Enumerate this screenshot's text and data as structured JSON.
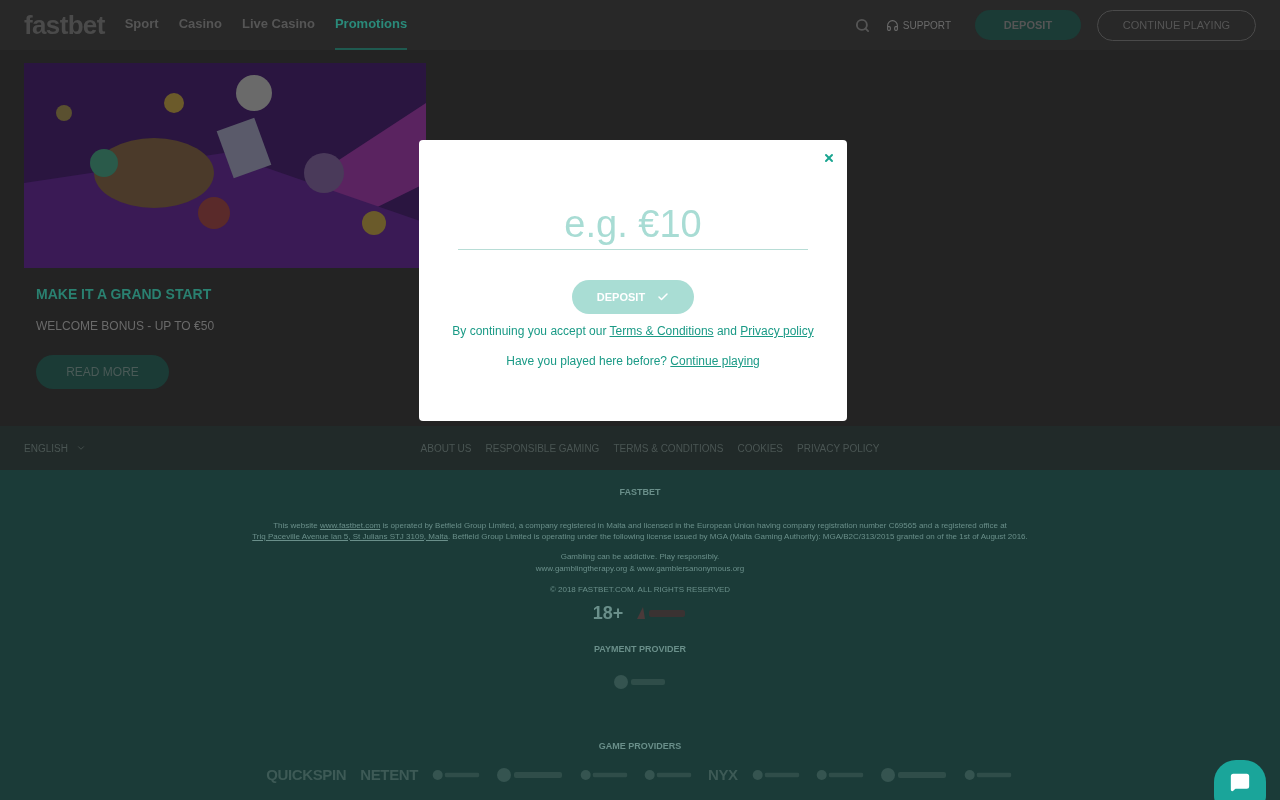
{
  "header": {
    "logo": "fastbet",
    "nav": [
      {
        "label": "Sport",
        "selected": false
      },
      {
        "label": "Casino",
        "selected": false
      },
      {
        "label": "Live Casino",
        "selected": false
      },
      {
        "label": "Promotions",
        "selected": true
      }
    ],
    "support": "SUPPORT",
    "deposit": "DEPOSIT",
    "continue": "CONTINUE PLAYING"
  },
  "promo": {
    "title": "MAKE IT A GRAND START",
    "subtitle": "WELCOME BONUS - UP TO €50",
    "button": "READ MORE"
  },
  "footer_nav": {
    "language": "ENGLISH",
    "links": [
      "ABOUT US",
      "RESPONSIBLE GAMING",
      "TERMS & CONDITIONS",
      "COOKIES",
      "PRIVACY POLICY"
    ]
  },
  "footer": {
    "brand": "FASTBET",
    "legal_before": "This website",
    "legal_link": "www.fastbet.com",
    "legal_middle": "is operated by Betfield Group Limited, a company registered in Malta and licensed in the European Union having company registration number C69565 and a registered office at",
    "legal_address": "Triq Paceville Avenue lan 5, St Julians STJ 3109, Malta",
    "legal_after": ". Betfield Group Limited is operating under the following license issued by MGA (Malta Gaming Authority): MGA/B2C/313/2015 granted on of the 1st of August 2016.",
    "gambling": "Gambling can be addictive. Play responsibly.",
    "help_links": "www.gamblingtherapy.org & www.gamblersanonymous.org",
    "copyright": "© 2018 FASTBET.COM. ALL RIGHTS RESERVED",
    "age": "18+",
    "payment_title": "PAYMENT PROVIDER",
    "providers_title": "GAME PROVIDERS",
    "providers": [
      {
        "kind": "text",
        "name": "QUICKSPIN"
      },
      {
        "kind": "text",
        "name": "NETENT"
      },
      {
        "kind": "mark"
      },
      {
        "kind": "mark"
      },
      {
        "kind": "mark"
      },
      {
        "kind": "mark"
      },
      {
        "kind": "text",
        "name": "NYX"
      },
      {
        "kind": "mark"
      },
      {
        "kind": "mark"
      },
      {
        "kind": "mark"
      },
      {
        "kind": "mark"
      }
    ]
  },
  "modal": {
    "placeholder": "e.g. €10",
    "button": "DEPOSIT",
    "button_disabled": true,
    "terms_before": "By continuing you accept our",
    "terms_link": "Terms & Conditions",
    "terms_and": "and",
    "privacy_link": "Privacy policy",
    "played_before": "Have you played here before?",
    "continue_link": "Continue playing"
  }
}
